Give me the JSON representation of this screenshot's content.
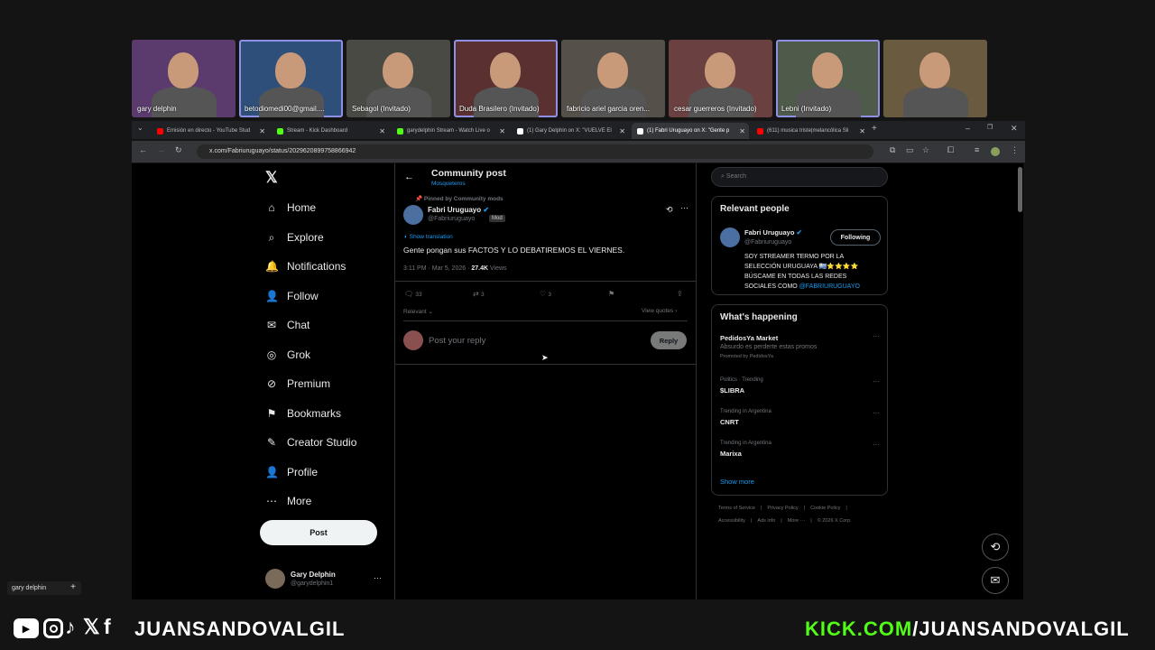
{
  "participants": [
    {
      "name": "gary delphin",
      "bg": "#5b3a6e",
      "hl": false
    },
    {
      "name": "betodiomedi00@gmail....",
      "bg": "#2e4f7a",
      "hl": true
    },
    {
      "name": "Sebagol (Invitado)",
      "bg": "#4a4a44",
      "hl": false
    },
    {
      "name": "Duda Brasilero (Invitado)",
      "bg": "#5a3030",
      "hl": true
    },
    {
      "name": "fabricio ariel garcia oren...",
      "bg": "#55504a",
      "hl": false
    },
    {
      "name": "cesar guerreros (Invitado)",
      "bg": "#6a4040",
      "hl": false
    },
    {
      "name": "Lebni (Invitado)",
      "bg": "#4e5a4a",
      "hl": true
    },
    {
      "name": "",
      "bg": "#6a5a40",
      "hl": false
    }
  ],
  "tabs": [
    {
      "label": "Emisión en directo - YouTube Stud",
      "color": "#ff0000"
    },
    {
      "label": "Stream - Kick Dashboard",
      "color": "#53fc18"
    },
    {
      "label": "garydelphin Stream - Watch Live o",
      "color": "#53fc18"
    },
    {
      "label": "(1) Gary Delphin on X: \"VUELVE El",
      "color": "#ffffff"
    },
    {
      "label": "(1) Fabri Uruguayo on X: \"Gente p",
      "color": "#ffffff"
    },
    {
      "label": "(611) musica triste|melancólica Sli",
      "color": "#ff0000"
    }
  ],
  "url": "x.com/Fabriuruguayo/status/2029620899758866942",
  "nav": {
    "logo": "𝕏",
    "items": [
      "Home",
      "Explore",
      "Notifications",
      "Follow",
      "Chat",
      "Grok",
      "Premium",
      "Bookmarks",
      "Creator Studio",
      "Profile",
      "More"
    ],
    "post_label": "Post",
    "account_name": "Gary Delphin",
    "account_handle": "@garydelphin1"
  },
  "post": {
    "header_title": "Community post",
    "community": "Mosqueteros",
    "pinned": "Pinned by Community mods",
    "author": "Fabri Uruguayo",
    "handle": "@Fabriuruguayo",
    "badge": "Mod",
    "show_translation": "Show translation",
    "text": "Gente pongan sus FACTOS Y LO DEBATIREMOS EL VIERNES.",
    "time": "3:11 PM · Mar 5, 2026 ·",
    "views_count": "27.4K",
    "views_label": "Views",
    "replies": "33",
    "reposts": "3",
    "likes": "3",
    "sort": "Relevant",
    "view_quotes": "View quotes",
    "reply_placeholder": "Post your reply",
    "reply_button": "Reply"
  },
  "sidebar": {
    "search_placeholder": "Search",
    "relevant_title": "Relevant people",
    "person_name": "Fabri Uruguayo",
    "person_handle": "@Fabriuruguayo",
    "following": "Following",
    "bio": "SOY STREAMER TERMO POR LA SELECCIÓN URUGUAYA 🇺🇾⭐⭐⭐⭐ BÚSCAME EN TODAS LAS REDES SOCIALES COMO",
    "bio_link": "@FABRIURUGUAYO",
    "happening_title": "What's happening",
    "trends": [
      {
        "meta": "",
        "title": "PedidosYa Market",
        "sub": "Absurdo es perderte estas promos",
        "promo": "Promoted by PedidosYa"
      },
      {
        "meta": "Politics · Trending",
        "title": "$LIBRA",
        "sub": "",
        "promo": ""
      },
      {
        "meta": "Trending in Argentina",
        "title": "CNRT",
        "sub": "",
        "promo": ""
      },
      {
        "meta": "Trending in Argentina",
        "title": "Marixa",
        "sub": "",
        "promo": ""
      }
    ],
    "show_more": "Show more",
    "footer1": [
      "Terms of Service",
      "Privacy Policy",
      "Cookie Policy"
    ],
    "footer2": [
      "Accessibility",
      "Ads info",
      "More ···",
      "© 2026 X Corp."
    ]
  },
  "overlay": {
    "brand_left": "JUANSANDOVALGIL",
    "kick_prefix": "KICK.COM",
    "kick_rest": "/JUANSANDOVALGIL",
    "obs_label": "gary delphin"
  }
}
